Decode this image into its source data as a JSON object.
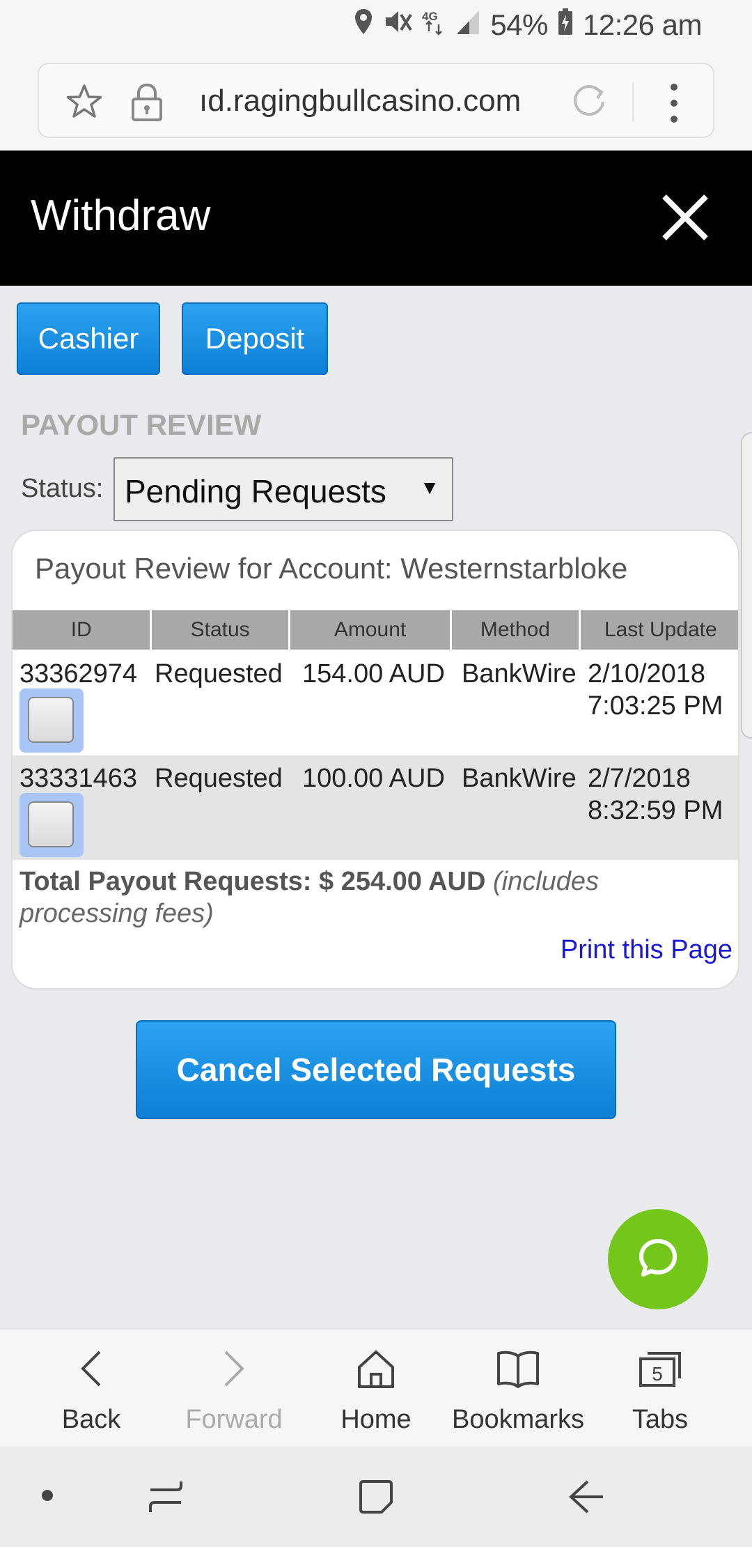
{
  "status_bar": {
    "battery": "54%",
    "time": "12:26 am",
    "network": "4G"
  },
  "browser": {
    "url": "ıd.ragingbullcasino.com"
  },
  "header": {
    "title": "Withdraw"
  },
  "nav_buttons": {
    "cashier": "Cashier",
    "deposit": "Deposit"
  },
  "payout": {
    "heading": "PAYOUT REVIEW",
    "status_label": "Status:",
    "status_selected": "Pending Requests",
    "card_title": "Payout Review for Account: Westernstarbloke",
    "columns": [
      "ID",
      "Status",
      "Amount",
      "Method",
      "Last Update"
    ],
    "rows": [
      {
        "id": "33362974",
        "status": "Requested",
        "amount": "154.00 AUD",
        "method": "BankWire",
        "date": "2/10/2018",
        "time": "7:03:25 PM"
      },
      {
        "id": "33331463",
        "status": "Requested",
        "amount": "100.00 AUD",
        "method": "BankWire",
        "date": "2/7/2018",
        "time": "8:32:59 PM"
      }
    ],
    "total_label": "Total Payout Requests: $ 254.00 AUD",
    "total_note": "(includes processing fees)",
    "print_link": "Print this Page",
    "cancel_button": "Cancel Selected Requests"
  },
  "toolbar": {
    "back": "Back",
    "forward": "Forward",
    "home": "Home",
    "bookmarks": "Bookmarks",
    "tabs": "Tabs",
    "tabs_count": "5"
  },
  "colors": {
    "accent_blue": "#0d7fd6",
    "chat_green": "#74c61a",
    "link_blue": "#1a1ad6"
  }
}
